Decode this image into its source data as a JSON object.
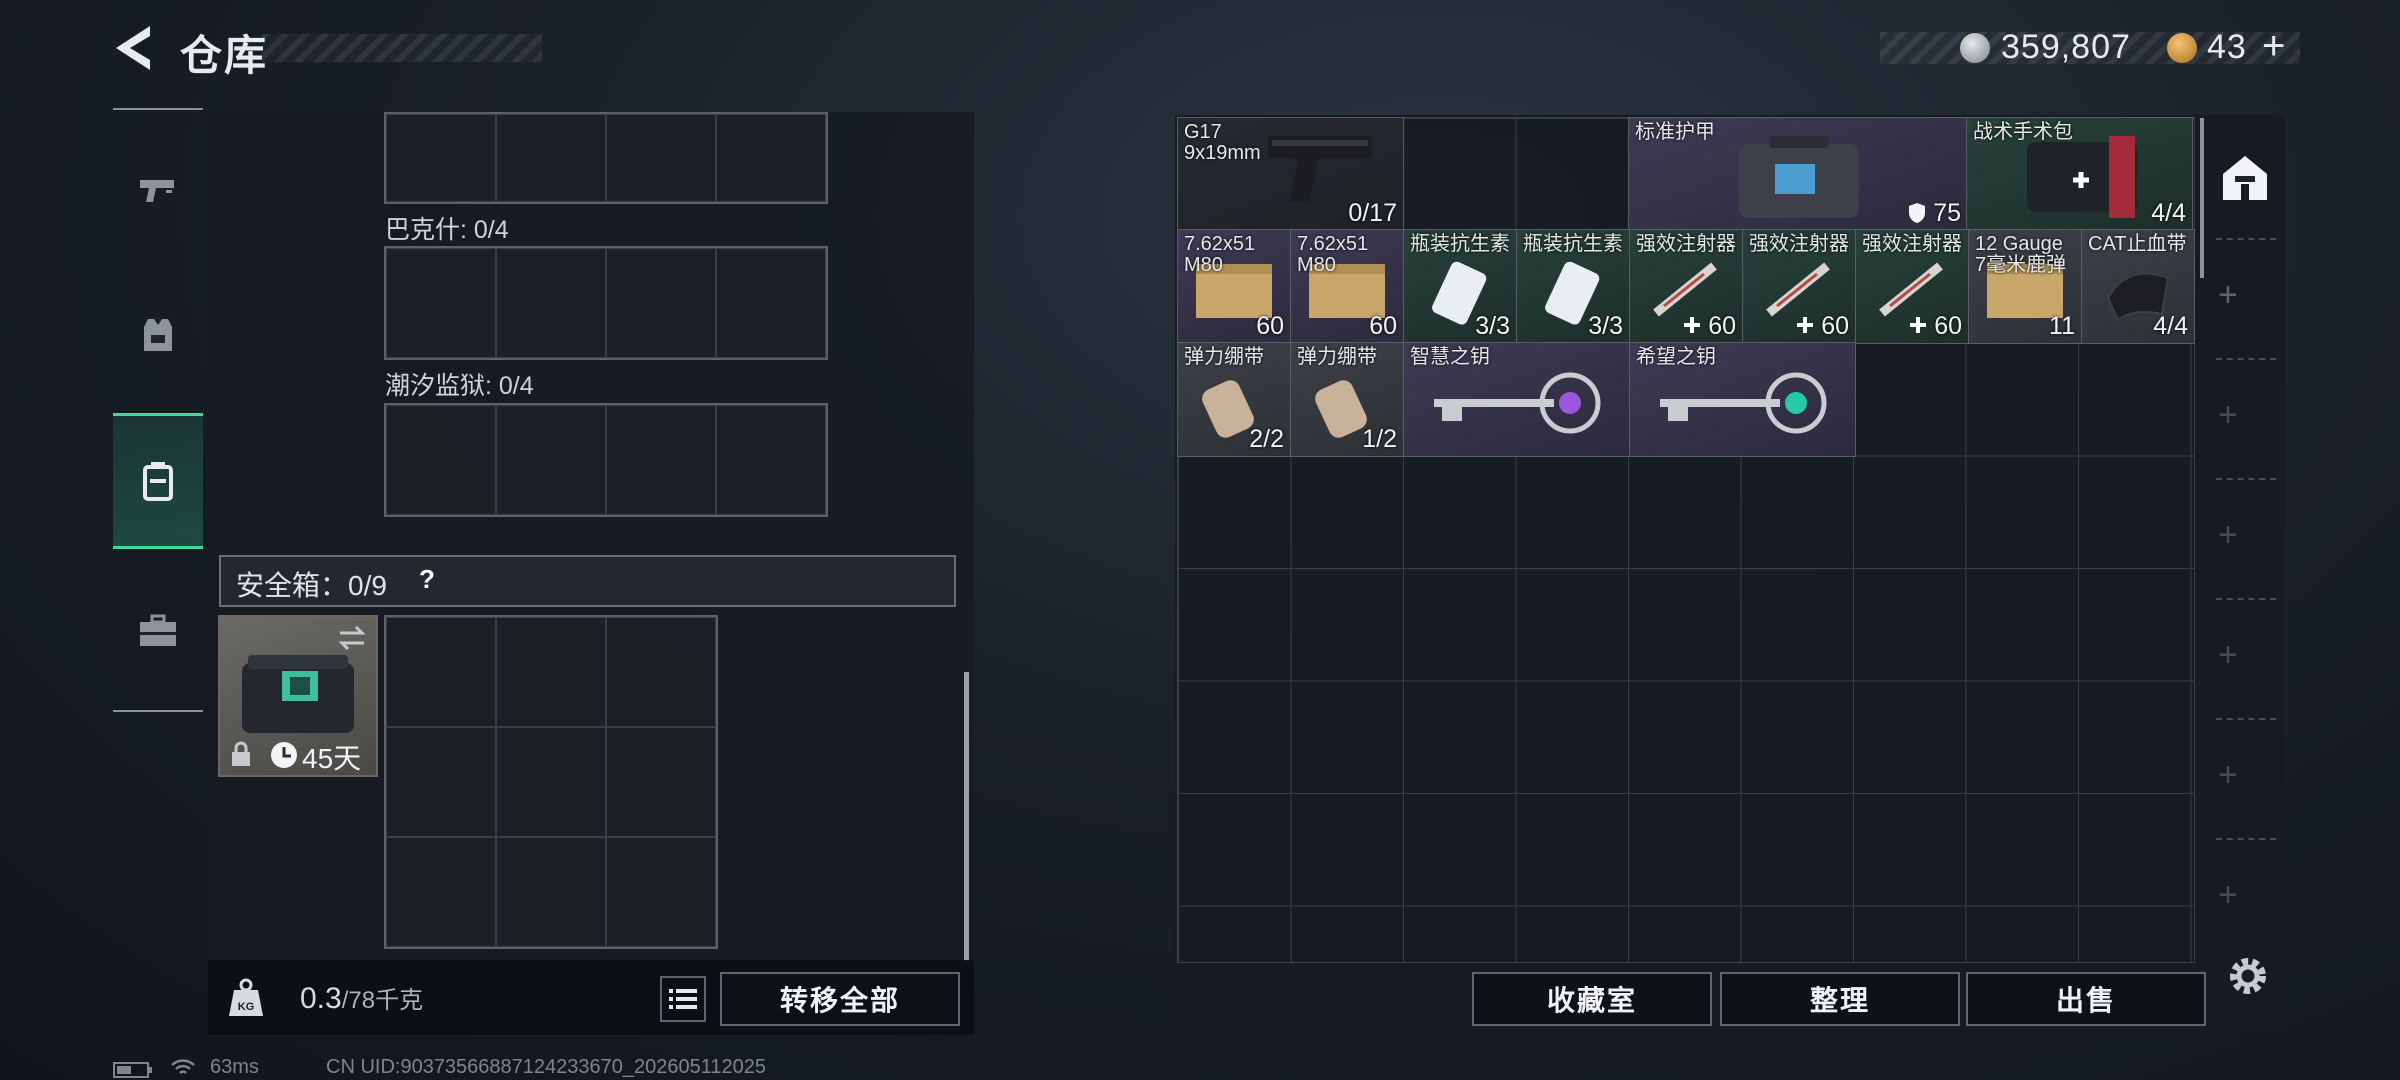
{
  "header": {
    "title": "仓库"
  },
  "currency": [
    {
      "name": "silver-coin-icon",
      "value": "359,807",
      "color": "#9aa1a8"
    },
    {
      "name": "gold-coin-icon",
      "value": "43",
      "plus": "+",
      "color": "#c8913c"
    }
  ],
  "left_tabs": [
    {
      "name": "weapon-tab-icon",
      "active": false
    },
    {
      "name": "armor-tab-icon",
      "active": false
    },
    {
      "name": "backpack-tab-icon",
      "active": true
    },
    {
      "name": "toolbox-tab-icon",
      "active": false
    }
  ],
  "sections": [
    {
      "label": "巴克什: 0/4"
    },
    {
      "label": "潮汐监狱: 0/4"
    }
  ],
  "safe_box": {
    "label": "安全箱：0/9",
    "help": "?",
    "duration": "45天"
  },
  "footer": {
    "weight_value": "0.3",
    "weight_max": "/78千克",
    "transfer_all": "转移全部"
  },
  "items": [
    {
      "name": "G17\n9x19mm",
      "count": "0/17"
    },
    {
      "name": "标准护甲",
      "count": "75"
    },
    {
      "name": "战术手术包",
      "count": "4/4"
    },
    {
      "name": "7.62x51\nM80",
      "count": "60"
    },
    {
      "name": "7.62x51\nM80",
      "count": "60"
    },
    {
      "name": "瓶装抗生素",
      "count": "3/3"
    },
    {
      "name": "瓶装抗生素",
      "count": "3/3"
    },
    {
      "name": "强效注射器",
      "count": "60"
    },
    {
      "name": "强效注射器",
      "count": "60"
    },
    {
      "name": "强效注射器",
      "count": "60"
    },
    {
      "name": "12 Gauge\n7毫米鹿弹",
      "count": "11"
    },
    {
      "name": "CAT止血带",
      "count": "4/4"
    },
    {
      "name": "弹力绷带",
      "count": "2/2"
    },
    {
      "name": "弹力绷带",
      "count": "1/2"
    },
    {
      "name": "智慧之钥",
      "count": ""
    },
    {
      "name": "希望之钥",
      "count": ""
    }
  ],
  "right_buttons": {
    "collection": "收藏室",
    "sort": "整理",
    "sell": "出售"
  },
  "status_bar": {
    "ping": "63ms",
    "uid": "CN UID:90373566887124233670_202605112025"
  }
}
